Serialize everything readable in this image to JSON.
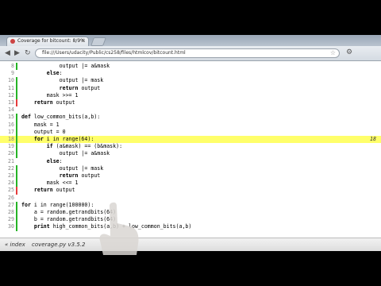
{
  "browser": {
    "tab_title": "Coverage for bitcount: 8/9%",
    "url": "file:///Users/udacity/Public/cs258/files/htmlcov/bitcount.html"
  },
  "code": {
    "lines": [
      {
        "n": "8",
        "indent": 12,
        "text": "output |= a&mask",
        "kw": "",
        "status": "run",
        "hl": false,
        "annot": ""
      },
      {
        "n": "9",
        "indent": 8,
        "text": "else:",
        "kw": "else",
        "status": "none",
        "hl": false,
        "annot": ""
      },
      {
        "n": "10",
        "indent": 12,
        "text": "output |= mask",
        "kw": "",
        "status": "run",
        "hl": false,
        "annot": ""
      },
      {
        "n": "11",
        "indent": 12,
        "text": "return output",
        "kw": "return",
        "status": "run",
        "hl": false,
        "annot": ""
      },
      {
        "n": "12",
        "indent": 8,
        "text": "mask >>= 1",
        "kw": "",
        "status": "run",
        "hl": false,
        "annot": ""
      },
      {
        "n": "13",
        "indent": 4,
        "text": "return output",
        "kw": "return",
        "status": "miss",
        "hl": false,
        "annot": ""
      },
      {
        "n": "14",
        "indent": 0,
        "text": "",
        "kw": "",
        "status": "none",
        "hl": false,
        "annot": ""
      },
      {
        "n": "15",
        "indent": 0,
        "text": "def low_common_bits(a,b):",
        "kw": "def",
        "status": "run",
        "hl": false,
        "annot": ""
      },
      {
        "n": "16",
        "indent": 4,
        "text": "mask = 1",
        "kw": "",
        "status": "run",
        "hl": false,
        "annot": ""
      },
      {
        "n": "17",
        "indent": 4,
        "text": "output = 0",
        "kw": "",
        "status": "run",
        "hl": false,
        "annot": ""
      },
      {
        "n": "18",
        "indent": 4,
        "text": "for i in range(64):",
        "kw": "for",
        "status": "run",
        "hl": true,
        "annot": "18"
      },
      {
        "n": "19",
        "indent": 8,
        "text": "if (a&mask) == (b&mask):",
        "kw": "if",
        "status": "run",
        "hl": false,
        "annot": ""
      },
      {
        "n": "20",
        "indent": 12,
        "text": "output |= a&mask",
        "kw": "",
        "status": "run",
        "hl": false,
        "annot": ""
      },
      {
        "n": "21",
        "indent": 8,
        "text": "else:",
        "kw": "else",
        "status": "none",
        "hl": false,
        "annot": ""
      },
      {
        "n": "22",
        "indent": 12,
        "text": "output |= mask",
        "kw": "",
        "status": "run",
        "hl": false,
        "annot": ""
      },
      {
        "n": "23",
        "indent": 12,
        "text": "return output",
        "kw": "return",
        "status": "run",
        "hl": false,
        "annot": ""
      },
      {
        "n": "24",
        "indent": 8,
        "text": "mask <<= 1",
        "kw": "",
        "status": "run",
        "hl": false,
        "annot": ""
      },
      {
        "n": "25",
        "indent": 4,
        "text": "return output",
        "kw": "return",
        "status": "miss",
        "hl": false,
        "annot": ""
      },
      {
        "n": "26",
        "indent": 0,
        "text": "",
        "kw": "",
        "status": "none",
        "hl": false,
        "annot": ""
      },
      {
        "n": "27",
        "indent": 0,
        "text": "for i in range(100000):",
        "kw": "for",
        "status": "run",
        "hl": false,
        "annot": ""
      },
      {
        "n": "28",
        "indent": 4,
        "text": "a = random.getrandbits(64)",
        "kw": "",
        "status": "run",
        "hl": false,
        "annot": ""
      },
      {
        "n": "29",
        "indent": 4,
        "text": "b = random.getrandbits(64)",
        "kw": "",
        "status": "run",
        "hl": false,
        "annot": ""
      },
      {
        "n": "30",
        "indent": 4,
        "text": "print high_common_bits(a,b) + low_common_bits(a,b)",
        "kw": "print",
        "status": "run",
        "hl": false,
        "annot": ""
      }
    ]
  },
  "footer": {
    "index_link": "« index",
    "version": "coverage.py v3.5.2"
  },
  "colors": {
    "run_bar": "#26b426",
    "miss_bar": "#e53c3c",
    "highlight": "#ffff6a"
  }
}
